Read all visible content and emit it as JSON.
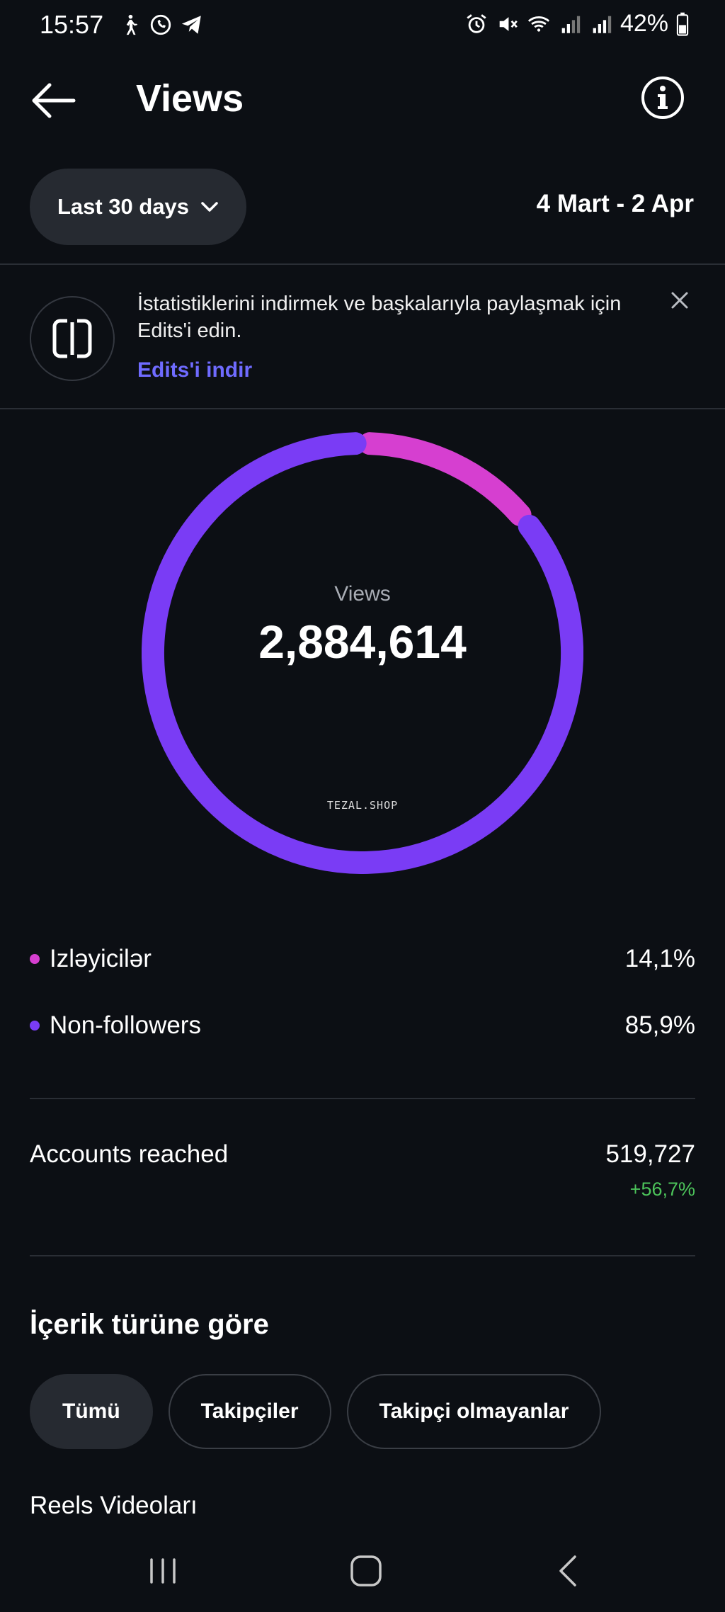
{
  "status_bar": {
    "time": "15:57",
    "battery": "42%",
    "left_icons": [
      "walking-icon",
      "whatsapp-icon",
      "telegram-icon"
    ],
    "right_icons": [
      "alarm-icon",
      "mute-icon",
      "wifi-icon",
      "signal-icon",
      "signal-icon",
      "battery-icon"
    ]
  },
  "header": {
    "title": "Views"
  },
  "range": {
    "selector_label": "Last 30 days",
    "dates": "4 Mart - 2 Apr"
  },
  "banner": {
    "text": "İstatistiklerini indirmek ve başkalarıyla paylaşmak için Edits'i edin.",
    "link": "Edits'i indir"
  },
  "summary": {
    "label": "Views",
    "value": "2,884,614",
    "watermark": "TEZAL.SHOP"
  },
  "chart_data": {
    "type": "pie",
    "categories": [
      "Izləyicilər",
      "Non-followers"
    ],
    "values": [
      14.1,
      85.9
    ],
    "colors": [
      "#d63fd0",
      "#7a3cf5"
    ]
  },
  "legend": [
    {
      "label": "Izləyicilər",
      "value": "14,1%",
      "color": "#d63fd0"
    },
    {
      "label": "Non-followers",
      "value": "85,9%",
      "color": "#7a3cf5"
    }
  ],
  "accounts": {
    "label": "Accounts reached",
    "value": "519,727",
    "change": "+56,7%"
  },
  "content": {
    "title": "İçerik türüne göre",
    "tabs": [
      "Tümü",
      "Takipçiler",
      "Takipçi olmayanlar"
    ],
    "active_tab": "Tümü",
    "first_item": "Reels Videoları"
  },
  "colors": {
    "background": "#0c0f14",
    "accent": "#6f6bff",
    "positive": "#4cc35a"
  }
}
